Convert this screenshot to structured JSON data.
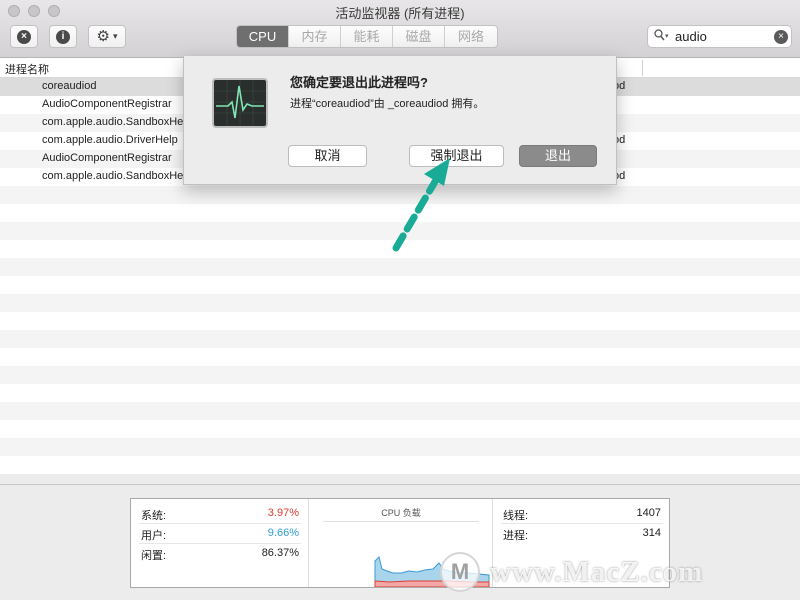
{
  "window": {
    "title": "活动监视器 (所有进程)"
  },
  "toolbar": {
    "close_process_icon": "×",
    "info_icon": "i",
    "gear_icon": "⚙",
    "gear_chevron": "▾",
    "tabs": [
      {
        "label": "CPU",
        "active": true
      },
      {
        "label": "内存",
        "active": false
      },
      {
        "label": "能耗",
        "active": false
      },
      {
        "label": "磁盘",
        "active": false
      },
      {
        "label": "网络",
        "active": false
      }
    ],
    "search": {
      "value": "audio",
      "clear_icon": "×"
    }
  },
  "table": {
    "headers": {
      "name": "进程名称"
    },
    "rows": [
      {
        "name": "coreaudiod",
        "user": "od",
        "selected": true
      },
      {
        "name": "AudioComponentRegistrar",
        "user": ""
      },
      {
        "name": "com.apple.audio.SandboxHe",
        "user": ""
      },
      {
        "name": "com.apple.audio.DriverHelp",
        "user": "od"
      },
      {
        "name": "AudioComponentRegistrar",
        "user": ""
      },
      {
        "name": "com.apple.audio.SandboxHe",
        "user": "od"
      }
    ]
  },
  "dialog": {
    "title": "您确定要退出此进程吗?",
    "message": "进程“coreaudiod”由 _coreaudiod 拥有。",
    "buttons": {
      "cancel": "取消",
      "force_quit": "强制退出",
      "quit": "退出"
    }
  },
  "stats": {
    "system": {
      "label": "系统:",
      "value": "3.97%",
      "color": "#e03c31"
    },
    "user": {
      "label": "用户:",
      "value": "9.66%",
      "color": "#2f9fd8"
    },
    "idle": {
      "label": "闲置:",
      "value": "86.37%",
      "color": "#222222"
    },
    "cpu_load_title": "CPU 负载",
    "threads": {
      "label": "线程:",
      "value": "1407"
    },
    "processes": {
      "label": "进程:",
      "value": "314"
    }
  },
  "annotation": {
    "arrow_color": "#1aab96"
  },
  "watermark": {
    "text": "www.MacZ.com"
  }
}
